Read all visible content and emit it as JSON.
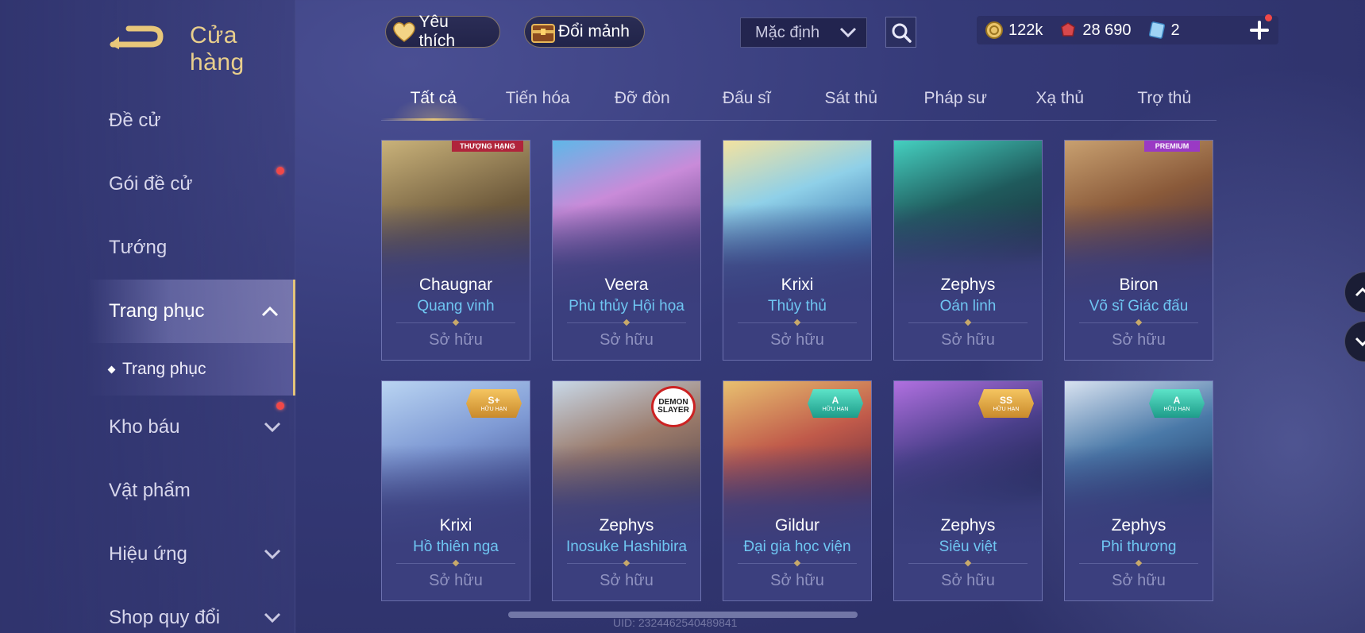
{
  "header": {
    "title": "Cửa hàng",
    "favorite_label": "Yêu thích",
    "exchange_label": "Đổi mảnh",
    "sort_value": "Mặc định"
  },
  "currency": {
    "gold": "122k",
    "gems": "28 690",
    "vouchers": "2"
  },
  "sidebar": {
    "items": [
      {
        "label": "Đề cử"
      },
      {
        "label": "Gói đề cử"
      },
      {
        "label": "Tướng"
      },
      {
        "label": "Trang phục"
      },
      {
        "label": "Trang phục"
      },
      {
        "label": "Kho báu"
      },
      {
        "label": "Vật phẩm"
      },
      {
        "label": "Hiệu ứng"
      },
      {
        "label": "Shop quy đổi"
      }
    ]
  },
  "tabs": [
    "Tất cả",
    "Tiến hóa",
    "Đỡ đòn",
    "Đấu sĩ",
    "Sát thủ",
    "Pháp sư",
    "Xạ thủ",
    "Trợ thủ"
  ],
  "cards": [
    {
      "hero": "Chaugnar",
      "skin": "Quang vinh",
      "status": "Sở hữu",
      "badge": "THƯỢNG HẠNG",
      "color": "#7a6a4a"
    },
    {
      "hero": "Veera",
      "skin": "Phù thủy Hội họa",
      "status": "Sở hữu",
      "color": "#8a5bb0"
    },
    {
      "hero": "Krixi",
      "skin": "Thủy thủ",
      "status": "Sở hữu",
      "color": "#5b9bc8"
    },
    {
      "hero": "Zephys",
      "skin": "Oán linh",
      "status": "Sở hữu",
      "color": "#2f6b6a"
    },
    {
      "hero": "Biron",
      "skin": "Võ sĩ Giác đấu",
      "status": "Sở hữu",
      "badge": "PREMIUM",
      "color": "#8a5a3a"
    },
    {
      "hero": "Krixi",
      "skin": "Hồ thiên nga",
      "status": "Sở hữu",
      "badge": "S+",
      "badge_sub": "HỮU HẠN",
      "color": "#7f9ad4"
    },
    {
      "hero": "Zephys",
      "skin": "Inosuke Hashibira",
      "status": "Sở hữu",
      "badge": "DEMON SLAYER",
      "color": "#9a7a6a"
    },
    {
      "hero": "Gildur",
      "skin": "Đại gia học viện",
      "status": "Sở hữu",
      "badge": "A",
      "badge_sub": "HỮU HẠN",
      "color": "#a0573e"
    },
    {
      "hero": "Zephys",
      "skin": "Siêu việt",
      "status": "Sở hữu",
      "badge": "SS",
      "badge_sub": "HỮU HẠN",
      "color": "#4a3f8a"
    },
    {
      "hero": "Zephys",
      "skin": "Phi thương",
      "status": "Sở hữu",
      "badge": "A",
      "badge_sub": "HỮU HẠN",
      "color": "#4a79a8"
    }
  ],
  "footer": {
    "uid": "UID: 2324462540489841"
  },
  "colors": {
    "accent_gold": "#e4c47a",
    "skin_blue": "#6fc6f2",
    "notify_red": "#f04848"
  }
}
